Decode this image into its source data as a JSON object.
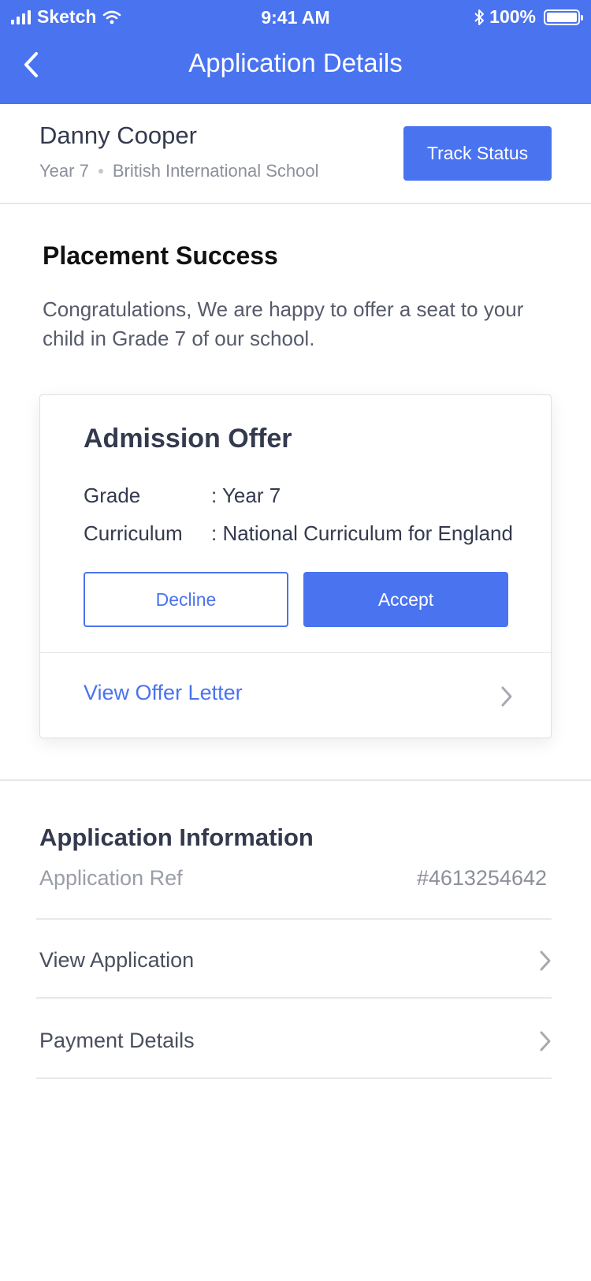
{
  "status_bar": {
    "carrier": "Sketch",
    "time": "9:41 AM",
    "battery": "100%"
  },
  "nav": {
    "title": "Application Details"
  },
  "profile": {
    "name": "Danny Cooper",
    "year": "Year 7",
    "school": "British International School",
    "track_button": "Track Status"
  },
  "placement": {
    "title": "Placement Success",
    "message": "Congratulations, We are happy to offer a seat to your child in Grade 7 of our school."
  },
  "offer": {
    "title": "Admission Offer",
    "rows": [
      {
        "label": "Grade",
        "value": ": Year 7"
      },
      {
        "label": "Curriculum",
        "value": ": National Curriculum for England"
      }
    ],
    "decline": "Decline",
    "accept": "Accept",
    "view_letter": "View Offer Letter"
  },
  "application_info": {
    "title": "Application Information",
    "ref_label": "Application Ref",
    "ref_value": "#4613254642",
    "items": [
      {
        "label": "View Application"
      },
      {
        "label": "Payment Details"
      }
    ]
  },
  "colors": {
    "accent": "#4a73f0",
    "text": "#343a4e",
    "muted": "#8c909b"
  }
}
